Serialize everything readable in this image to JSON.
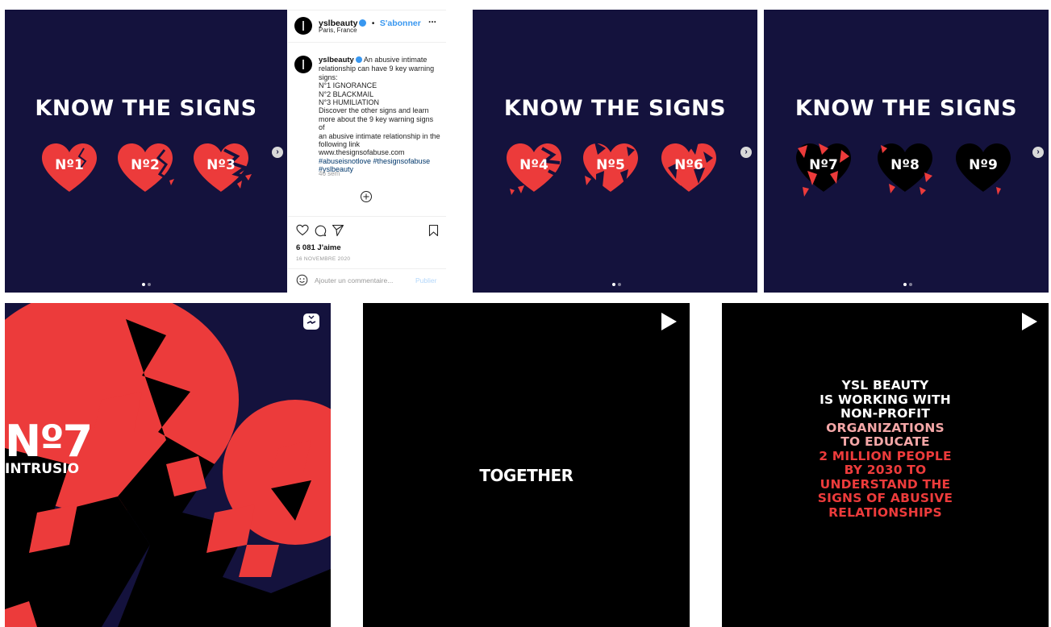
{
  "colors": {
    "navy": "#14123d",
    "red": "#ec3b3b",
    "black": "#000000",
    "pink": "#f4a7a7",
    "link_blue": "#3897f0"
  },
  "post1": {
    "title": "KNOW THE SIGNS",
    "hearts": [
      "Nº1",
      "Nº2",
      "Nº3"
    ]
  },
  "post2": {
    "title": "KNOW THE SIGNS",
    "hearts": [
      "Nº4",
      "Nº5",
      "Nº6"
    ]
  },
  "post3": {
    "title": "KNOW THE SIGNS",
    "hearts": [
      "Nº7",
      "Nº8",
      "Nº9"
    ]
  },
  "instagram": {
    "username": "yslbeauty",
    "separator": "•",
    "follow": "S'abonner",
    "location": "Paris, France",
    "more": "...",
    "caption_lines": [
      "An abusive intimate",
      "relationship can have 9 key warning",
      "signs:",
      "N°1 IGNORANCE",
      "N°2 BLACKMAIL",
      "N°3 HUMILIATION",
      "Discover the other signs and learn",
      "more about the 9 key warning signs of",
      "an abusive intimate relationship in the",
      "following link",
      "www.thesignsofabuse.com"
    ],
    "hashtags": [
      "#abuseisnotlove #thesignsofabuse",
      "#yslbeauty"
    ],
    "time_ago": "46 sem",
    "likes": "6 081 J'aime",
    "date": "16 NOVEMBRE 2020",
    "comment_placeholder": "Ajouter un commentaire...",
    "publish": "Publier",
    "icons": [
      "heart-icon",
      "comment-icon",
      "share-icon",
      "bookmark-icon",
      "add-circle-icon",
      "emoji-icon"
    ]
  },
  "bottom": {
    "video1": {
      "number": "Nº7",
      "word": "INTRUSIO"
    },
    "video2": {
      "text": "TOGETHER"
    },
    "video3": {
      "white_lines": [
        "YSL BEAUTY",
        "IS WORKING WITH",
        "NON-PROFIT"
      ],
      "pink_lines": [
        "ORGANIZATIONS",
        "TO EDUCATE"
      ],
      "red_lines": [
        "2 MILLION PEOPLE",
        "BY 2030 TO",
        "UNDERSTAND THE",
        "SIGNS OF ABUSIVE",
        "RELATIONSHIPS"
      ]
    }
  }
}
